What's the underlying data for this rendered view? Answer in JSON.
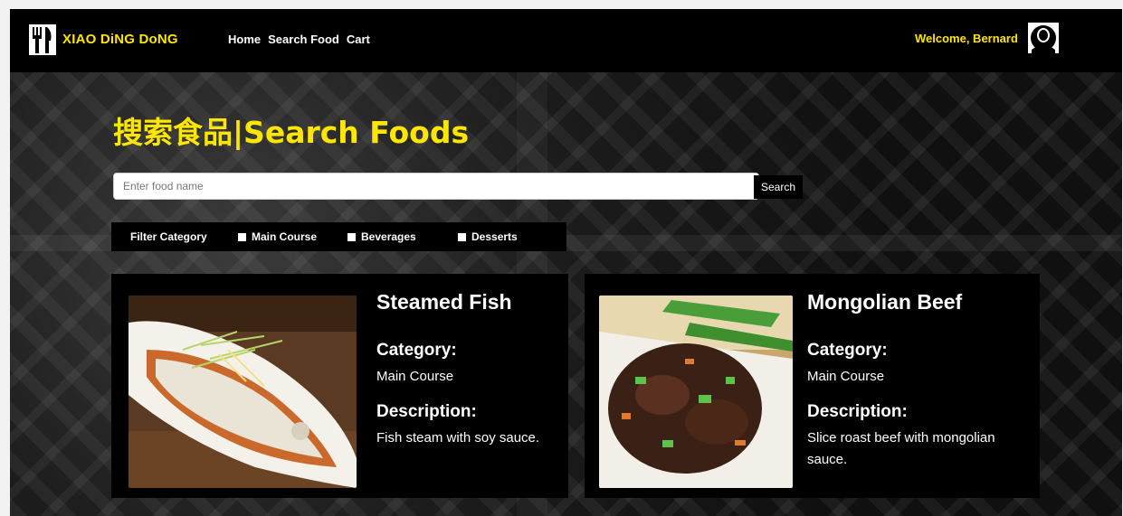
{
  "navbar": {
    "brand": "XIAO DiNG DoNG",
    "links": [
      "Home",
      "Search Food",
      "Cart"
    ],
    "welcome": "Welcome, Bernard"
  },
  "page": {
    "title": "搜索食品|Search Foods"
  },
  "search": {
    "placeholder": "Enter food name",
    "button": "Search"
  },
  "filter": {
    "label": "Filter Category",
    "options": [
      "Main Course",
      "Beverages",
      "Desserts"
    ]
  },
  "foods": [
    {
      "name": "Steamed Fish",
      "category_label": "Category:",
      "category": "Main Course",
      "description_label": "Description:",
      "description": "Fish steam with soy sauce."
    },
    {
      "name": "Mongolian Beef",
      "category_label": "Category:",
      "category": "Main Course",
      "description_label": "Description:",
      "description": "Slice roast beef with mongolian sauce."
    }
  ],
  "colors": {
    "accent": "#ffe600",
    "navbar": "#000000",
    "card": "#000000"
  },
  "icons": {
    "logo": "fork-knife-icon",
    "avatar": "user-avatar-icon"
  }
}
